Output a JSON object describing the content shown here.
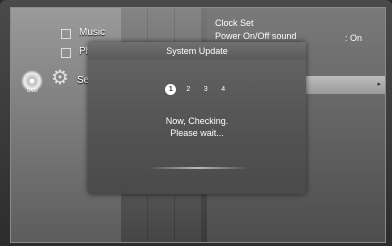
{
  "menu": {
    "items": [
      {
        "label": "Music",
        "icon": "music-note-icon"
      },
      {
        "label": "Ph",
        "icon": "photo-icon"
      },
      {
        "label": "Se",
        "icon": "gear-icon"
      }
    ],
    "disc_label": "DVD"
  },
  "settings": {
    "rows": [
      {
        "label": "Clock Set",
        "value": ""
      },
      {
        "label": "Power On/Off sound",
        "value": ": On"
      }
    ]
  },
  "dialog": {
    "title": "System Update",
    "steps": [
      "1",
      "2",
      "3",
      "4"
    ],
    "active_step": 1,
    "message_line1": "Now, Checking.",
    "message_line2": "Please wait..."
  }
}
